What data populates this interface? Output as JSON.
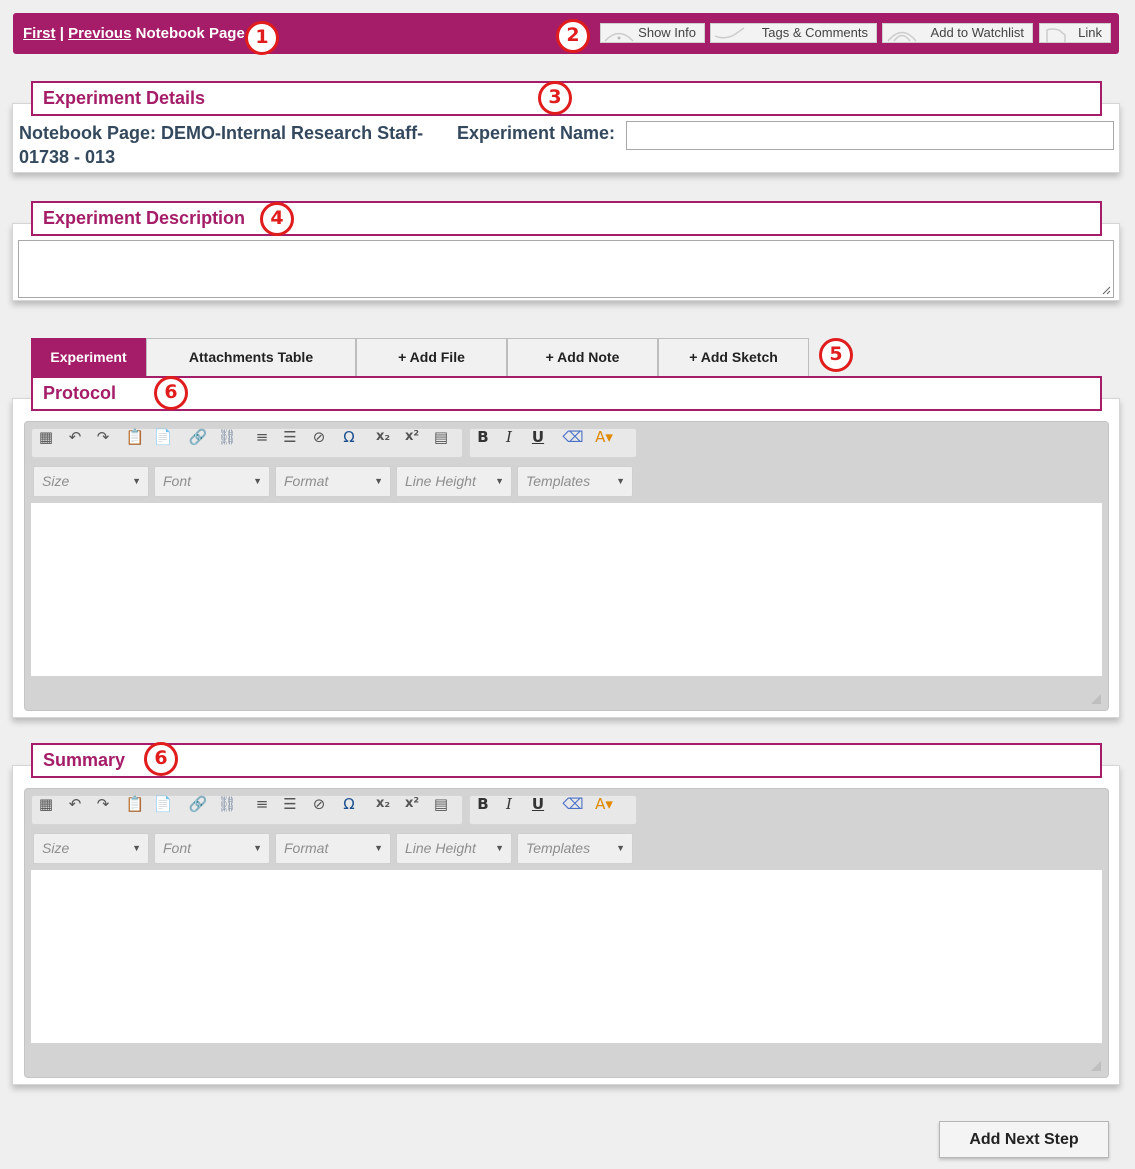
{
  "nav": {
    "first": "First",
    "separator": "|",
    "previous": "Previous",
    "suffix": "Notebook Page"
  },
  "top_buttons": {
    "show_info": "Show Info",
    "tags_comments": "Tags & Comments",
    "watchlist": "Add to Watchlist",
    "link": "Link"
  },
  "callouts": [
    "1",
    "2",
    "3",
    "4",
    "5",
    "6",
    "6"
  ],
  "experiment_details": {
    "title": "Experiment Details",
    "notebook_page_line1": "Notebook Page: DEMO-Internal Research Staff-",
    "notebook_page_line2": "01738 - 013",
    "experiment_name_label": "Experiment Name:",
    "experiment_name_value": ""
  },
  "experiment_description": {
    "title": "Experiment Description",
    "value": ""
  },
  "tabs": [
    {
      "label": "Experiment",
      "active": true
    },
    {
      "label": "Attachments Table",
      "active": false
    },
    {
      "label": "+ Add File",
      "active": false
    },
    {
      "label": "+ Add Note",
      "active": false
    },
    {
      "label": "+ Add Sketch",
      "active": false
    }
  ],
  "protocol": {
    "title": "Protocol"
  },
  "summary": {
    "title": "Summary"
  },
  "editor_combos": {
    "size": "Size",
    "font": "Font",
    "format": "Format",
    "line_height": "Line Height",
    "templates": "Templates"
  },
  "toolbar_icons": [
    "table-icon",
    "undo-icon",
    "redo-icon",
    "paste-text-icon",
    "paste-word-icon",
    "link-icon",
    "unlink-icon",
    "numbered-list-icon",
    "bulleted-list-icon",
    "horizontal-line-icon",
    "special-char-icon",
    "subscript-icon",
    "superscript-icon",
    "show-blocks-icon",
    "bold-icon",
    "italic-icon",
    "underline-icon",
    "remove-format-icon",
    "text-color-icon"
  ],
  "add_next_step": "Add Next Step",
  "colors": {
    "brand": "#a51d68",
    "callout": "#e01c1c",
    "label": "#34495e"
  }
}
